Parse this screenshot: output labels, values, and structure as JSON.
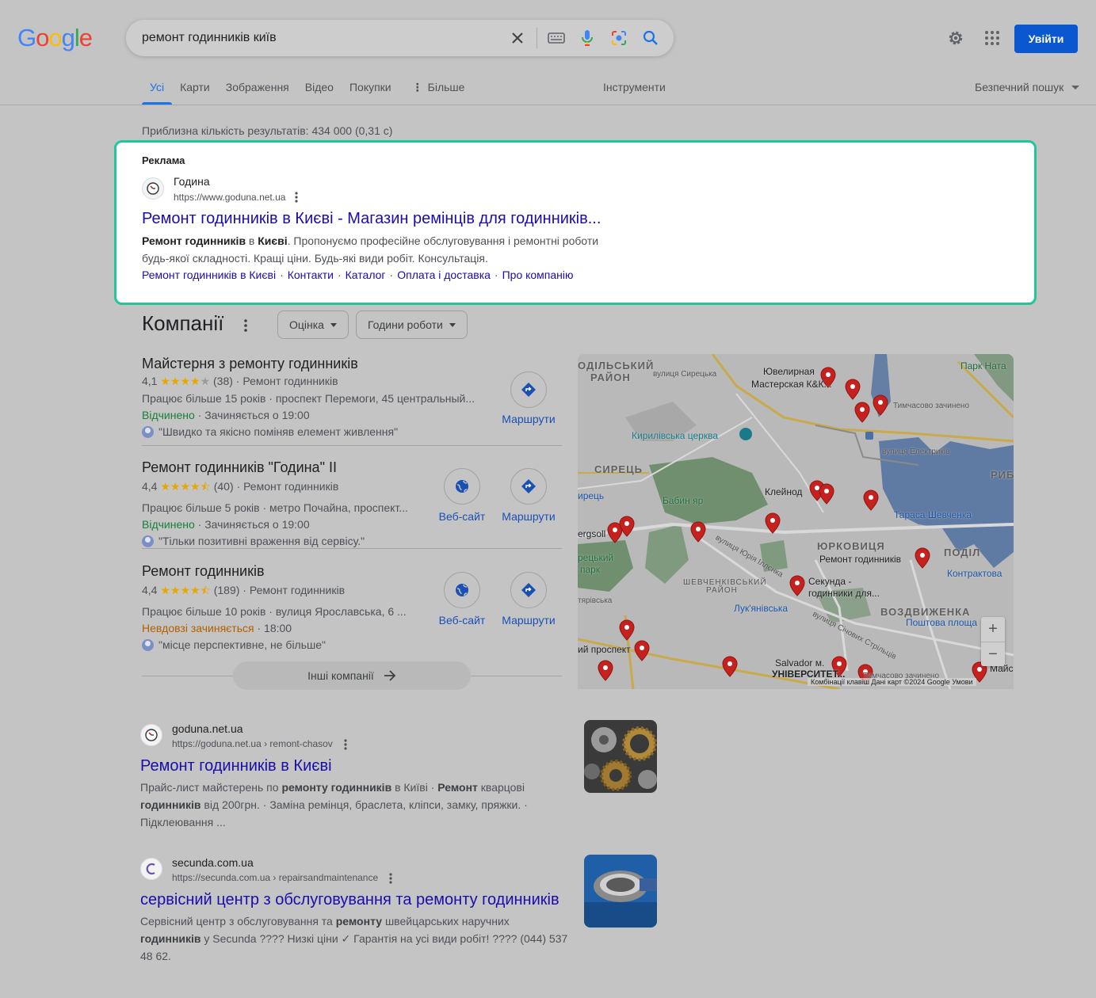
{
  "header": {
    "logo": [
      "G",
      "o",
      "o",
      "g",
      "l",
      "e"
    ],
    "query": "ремонт годинників київ",
    "sign_in": "Увійти"
  },
  "tabs": [
    "Усі",
    "Карти",
    "Зображення",
    "Відео",
    "Покупки",
    "Більше"
  ],
  "tools": "Інструменти",
  "safe_search": "Безпечний пошук",
  "stats": "Приблизна кількість результатів: 434 000 (0,31 с)",
  "ad": {
    "label": "Реклама",
    "site_name": "Година",
    "url": "https://www.goduna.net.ua",
    "title": "Ремонт годинників в Києві - Магазин ремінців для годинників...",
    "desc_bold_1": "Ремонт годинників",
    "desc_t1": " в ",
    "desc_bold_2": "Києві",
    "desc_t2": ". Пропонуємо професійне обслуговування і ремонтні роботи будь-якої складності. Кращі ціни. Будь-які види робіт. Консультація.",
    "sitelinks": [
      "Ремонт годинників в Києві",
      "Контакти",
      "Каталог",
      "Оплата і доставка",
      "Про компанію"
    ]
  },
  "companies": {
    "title": "Компанії",
    "filters": [
      "Оцінка",
      "Години роботи"
    ],
    "more": "Інші компанії",
    "website_label": "Веб-сайт",
    "directions_label": "Маршрути",
    "items": [
      {
        "name": "Майстерня з ремонту годинників",
        "rating": "4,1",
        "stars": 4,
        "reviews": "(38)",
        "category": "Ремонт годинників",
        "details": "Працює більше 15 років · проспект Перемоги, 45 центральный...",
        "status": "Відчинено",
        "hours": " · Зачиняється о 19:00",
        "review": "\"Швидко та якісно поміняв елемент живлення\""
      },
      {
        "name": "Ремонт годинників \"Година\" II",
        "rating": "4,4",
        "stars": 4.5,
        "reviews": "(40)",
        "category": "Ремонт годинників",
        "details": "Працює більше 5 років · метро Почайна, проспект...",
        "status": "Відчинено",
        "hours": " · Зачиняється о 19:00",
        "review": "\"Тільки позитивні враження від сервісу.\""
      },
      {
        "name": "Ремонт годинників",
        "rating": "4,4",
        "stars": 4.5,
        "reviews": "(189)",
        "category": "Ремонт годинників",
        "details": "Працює більше 10 років · вулиця Ярославська, 6 ...",
        "status": "Невдовзі зачиняється",
        "hours": " · 18:00",
        "review": "\"місце перспективне, не більше\""
      }
    ]
  },
  "map": {
    "labels": {
      "podilskyi": "ОДІЛЬСЬКИЙ",
      "raion": "РАЙОН",
      "jeweler": "Ювелирная",
      "jeweler2": "Мастерская К&К...",
      "syretska": "вулиця Сирецька",
      "temp_closed": "Тимчасово зачинено",
      "park": "Парк Ната",
      "kyrylivska": "Кирилівська церква",
      "elektrykiv": "вулиця Електриків",
      "syrets": "СИРЕЦЬ",
      "rybalskyi": "РИБА",
      "babyn_yar": "Бабин яр",
      "kleinod": "Клейнод",
      "shevchenka": "Тараса Шевченка",
      "syrets2": "ирець",
      "dergsoll": "ergsoll",
      "yurkovytsia": "ЮРКОВИЦЯ",
      "podil": "ПОДІЛ",
      "repair": "Ремонт годинників",
      "kontraktova": "Контрактова",
      "syretskyi": "рецький",
      "park2": "парк",
      "illienka": "вулиця Юрія Іллєнка",
      "shevchenkivskyi": "ШЕВЧЕНКІВСЬКИЙ",
      "raion2": "РАЙОН",
      "sekunda": "Секунда -",
      "sekunda2": "годинники для...",
      "lukianivska": "Лук'янівська",
      "vozdvyzhenka": "ВОЗДВИЖЕНКА",
      "poshtova": "Поштова площа",
      "tiarivska": "тярівська",
      "sichovykh": "вулиця Січових Стрільців",
      "prospekt": "ий проспект",
      "salvador": "Salvador м.",
      "universytet": "УНІВЕРСИТЕТ...",
      "temp_closed2": "Тимчасово зачинено",
      "mai": "Майс",
      "footer": "Комбінації клавіш   Дані карт ©2024 Google   Умови"
    }
  },
  "results": [
    {
      "site": "goduna.net.ua",
      "url": "https://goduna.net.ua › remont-chasov",
      "title": "Ремонт годинників в Києві",
      "desc_parts": [
        {
          "t": "Прайс-лист майстерень по "
        },
        {
          "b": "ремонту годинників"
        },
        {
          "t": " в Київі · "
        },
        {
          "b": "Ремонт"
        },
        {
          "t": " кварцові "
        },
        {
          "b": "годинників"
        },
        {
          "t": " від 200грн. · Заміна ремінця, браслета, кліпси, замку, пряжки. · Підклеювання ..."
        }
      ]
    },
    {
      "site": "secunda.com.ua",
      "url": "https://secunda.com.ua › repairsandmaintenance",
      "title": "сервісний центр з обслуговування та ремонту годинників",
      "desc_parts": [
        {
          "t": "Сервісний центр з обслуговування та "
        },
        {
          "b": "ремонту"
        },
        {
          "t": " швейцарських наручних "
        },
        {
          "b": "годинників"
        },
        {
          "t": " у Secunda ???? Низкі ціни ✓ Гарантія на усі види робіт! ???? (044) 537 48 62."
        }
      ]
    }
  ],
  "colors": {
    "accent": "#1a73e8",
    "link": "#1a0dab",
    "highlight_border": "#1fc79a",
    "open": "#188038",
    "closing": "#b06000",
    "pin": "#c5221f"
  }
}
